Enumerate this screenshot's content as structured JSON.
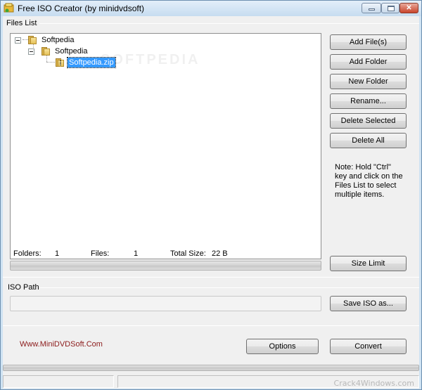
{
  "window": {
    "title": "Free ISO Creator (by minidvdsoft)",
    "controls": {
      "minimize": "minimize",
      "maximize": "maximize",
      "close": "close"
    }
  },
  "files_list": {
    "label": "Files List",
    "watermark": "SOFTPEDIA",
    "tree": [
      {
        "label": "Softpedia",
        "type": "folder",
        "level": 0,
        "expanded": true
      },
      {
        "label": "Softpedia",
        "type": "folder",
        "level": 1,
        "expanded": true
      },
      {
        "label": "Softpedia.zip",
        "type": "zip",
        "level": 2,
        "selected": true
      }
    ]
  },
  "side_buttons": {
    "add_files": "Add File(s)",
    "add_folder": "Add Folder",
    "new_folder": "New Folder",
    "rename": "Rename...",
    "delete_selected": "Delete Selected",
    "delete_all": "Delete All"
  },
  "note": "Note: Hold \"Ctrl\" key and click on the Files List to select multiple items.",
  "stats": {
    "folders_label": "Folders:",
    "folders_value": "1",
    "files_label": "Files:",
    "files_value": "1",
    "total_size_label": "Total Size:",
    "total_size_value": "22 B"
  },
  "size_progress": 0,
  "size_limit_button": "Size Limit",
  "iso_path": {
    "label": "ISO Path",
    "value": "",
    "save_button": "Save ISO as..."
  },
  "footer": {
    "site_link": "Www.MiniDVDSoft.Com",
    "options_button": "Options",
    "convert_button": "Convert"
  },
  "conversion_progress": 0,
  "statusbar": {
    "pane1": "",
    "pane2": "",
    "watermark": "Crack4Windows.com"
  }
}
